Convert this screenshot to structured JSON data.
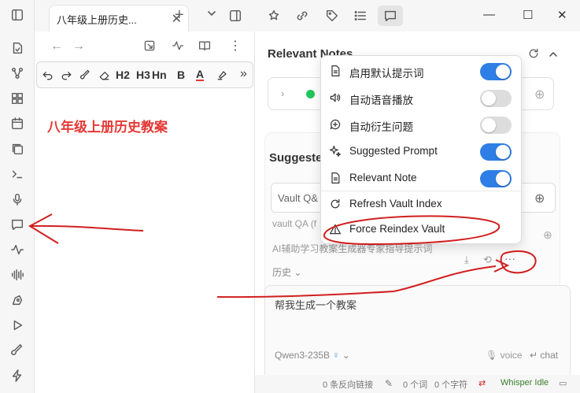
{
  "left_tab": {
    "title": "八年级上册历史..."
  },
  "document": {
    "heading": "八年级上册历史教案"
  },
  "toolbar": {
    "h2": "H2",
    "h3": "H3",
    "hn": "Hn",
    "bold": "B",
    "color": "A"
  },
  "right": {
    "relevant_notes_title": "Relevant Notes",
    "suggested_title": "Suggeste",
    "vault_input_placeholder": "Vault Q&",
    "vault_qa_label": "vault QA (f",
    "prompt_label": "AI辅助学习教案生成器专家指导提示词",
    "history_label": "历史",
    "chat_input": "帮我生成一个教案",
    "model": "Qwen3-235B",
    "voice": "voice",
    "chat": "chat"
  },
  "statusbar": {
    "backlinks": "0 条反向链接",
    "words": "0 个词",
    "chars": "0 个字符",
    "whisper": "Whisper Idle"
  },
  "menu": {
    "items": [
      {
        "label": "启用默认提示词",
        "toggle": true,
        "on": true,
        "icon": "document-icon"
      },
      {
        "label": "自动语音播放",
        "toggle": true,
        "on": false,
        "icon": "speaker-icon"
      },
      {
        "label": "自动衍生问题",
        "toggle": true,
        "on": false,
        "icon": "plus-chat-icon"
      },
      {
        "label": "Suggested Prompt",
        "toggle": true,
        "on": true,
        "icon": "sparkle-icon"
      },
      {
        "label": "Relevant Note",
        "toggle": true,
        "on": true,
        "icon": "document-icon"
      },
      {
        "label": "Refresh Vault Index",
        "toggle": false,
        "icon": "refresh-icon"
      },
      {
        "label": "Force Reindex Vault",
        "toggle": false,
        "icon": "warning-icon"
      }
    ]
  },
  "colors": {
    "accent": "#2f7ee6",
    "heading_red": "#e53935",
    "annotation_red": "#d11f1f"
  }
}
